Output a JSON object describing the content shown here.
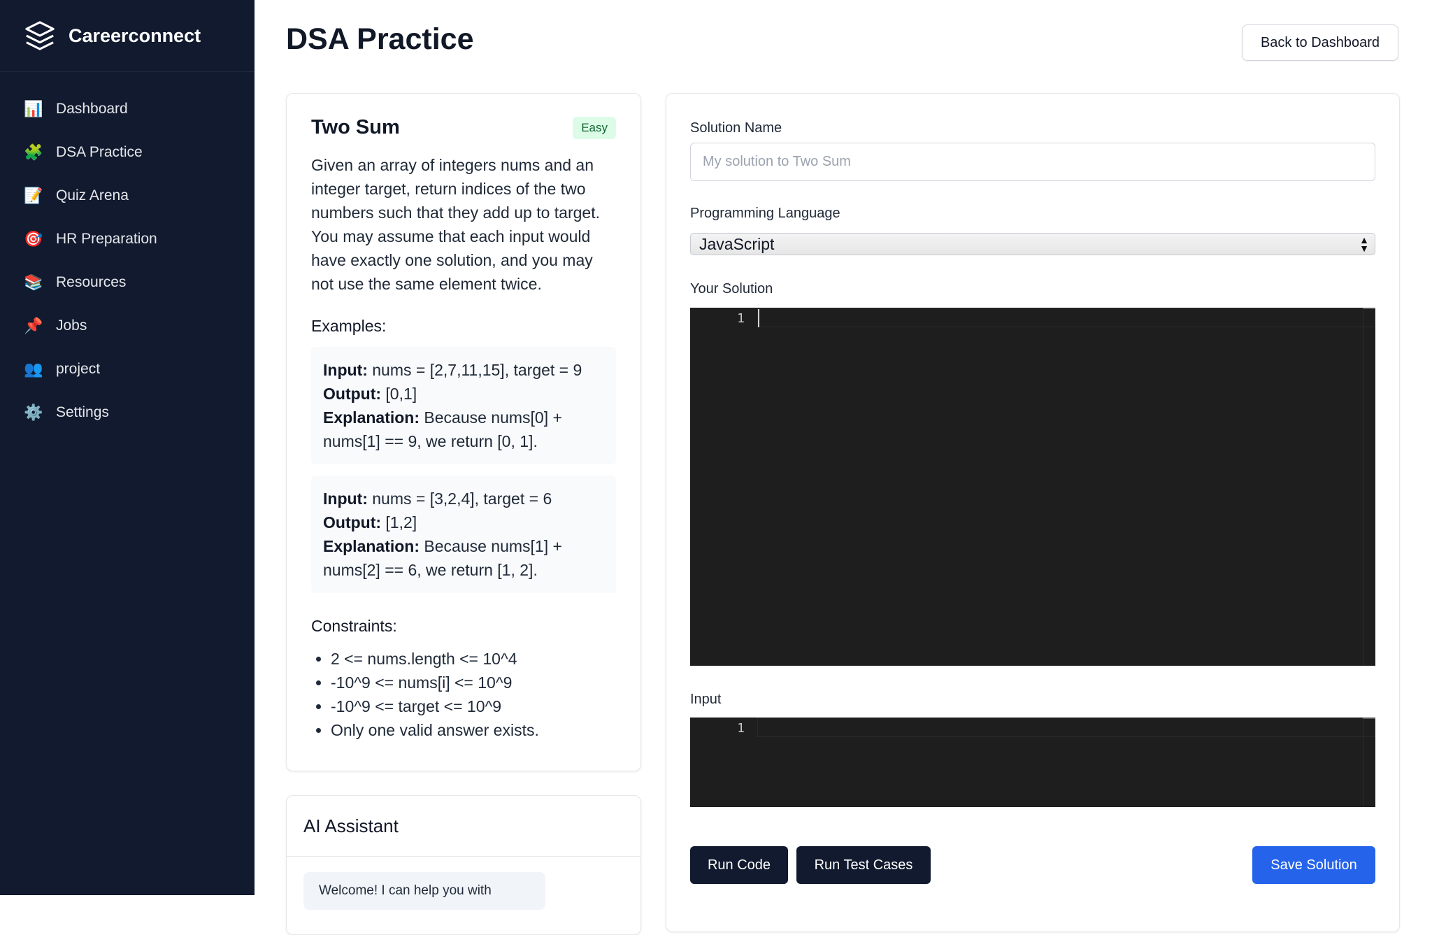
{
  "sidebar": {
    "brand": "Careerconnect",
    "items": [
      {
        "label": "Dashboard",
        "icon": "📊"
      },
      {
        "label": "DSA Practice",
        "icon": "🧩"
      },
      {
        "label": "Quiz Arena",
        "icon": "📝"
      },
      {
        "label": "HR Preparation",
        "icon": "🎯"
      },
      {
        "label": "Resources",
        "icon": "📚"
      },
      {
        "label": "Jobs",
        "icon": "📌"
      },
      {
        "label": "project",
        "icon": "👥"
      },
      {
        "label": "Settings",
        "icon": "⚙️"
      }
    ]
  },
  "header": {
    "title": "DSA Practice",
    "back_label": "Back to Dashboard"
  },
  "problem": {
    "title": "Two Sum",
    "difficulty": "Easy",
    "description": "Given an array of integers nums and an integer target, return indices of the two numbers such that they add up to target. You may assume that each input would have exactly one solution, and you may not use the same element twice.",
    "examples_heading": "Examples:",
    "input_label": "Input:",
    "output_label": "Output:",
    "explanation_label": "Explanation:",
    "examples": [
      {
        "input": "nums = [2,7,11,15], target = 9",
        "output": "[0,1]",
        "explanation": "Because nums[0] + nums[1] == 9, we return [0, 1]."
      },
      {
        "input": "nums = [3,2,4], target = 6",
        "output": "[1,2]",
        "explanation": "Because nums[1] + nums[2] == 6, we return [1, 2]."
      }
    ],
    "constraints_heading": "Constraints:",
    "constraints": [
      "2 <= nums.length <= 10^4",
      "-10^9 <= nums[i] <= 10^9",
      "-10^9 <= target <= 10^9",
      "Only one valid answer exists."
    ]
  },
  "ai_assistant": {
    "title": "AI Assistant",
    "message": "Welcome! I can help you with"
  },
  "editor": {
    "solution_name_label": "Solution Name",
    "solution_name_placeholder": "My solution to Two Sum",
    "language_label": "Programming Language",
    "language_value": "JavaScript",
    "solution_label": "Your Solution",
    "solution_line": "1",
    "input_label": "Input",
    "input_line": "1",
    "run_code": "Run Code",
    "run_tests": "Run Test Cases",
    "save": "Save Solution"
  },
  "colors": {
    "sidebar_bg": "#111a2e",
    "primary_blue": "#2563eb",
    "editor_bg": "#1e1e1e",
    "badge_bg": "#dcfce7"
  }
}
